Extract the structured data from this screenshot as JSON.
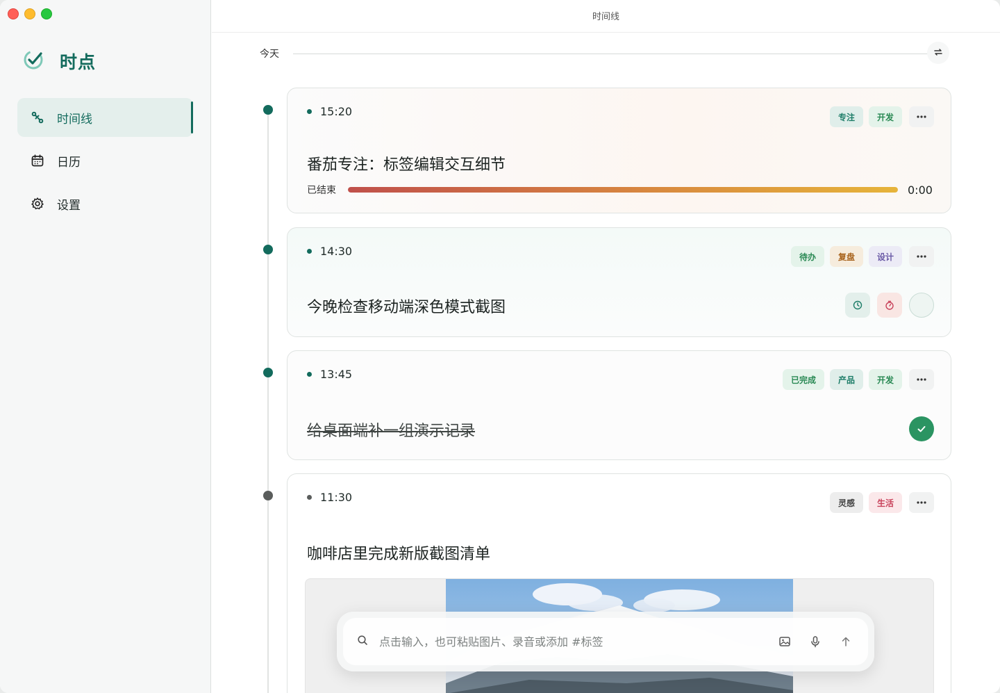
{
  "app": {
    "name": "时点",
    "window_title": "时间线"
  },
  "sidebar": {
    "items": [
      {
        "label": "时间线",
        "icon": "timeline-icon",
        "active": true
      },
      {
        "label": "日历",
        "icon": "calendar-icon",
        "active": false
      },
      {
        "label": "设置",
        "icon": "gear-icon",
        "active": false
      }
    ]
  },
  "timeline": {
    "day_label": "今天",
    "entries": [
      {
        "time": "15:20",
        "tags": [
          "专注",
          "开发"
        ],
        "title": "番茄专注：标签编辑交互细节",
        "status_label": "已结束",
        "remaining": "0:00",
        "progress": 1.0
      },
      {
        "time": "14:30",
        "tags": [
          "待办",
          "复盘",
          "设计"
        ],
        "title": "今晚检查移动端深色模式截图"
      },
      {
        "time": "13:45",
        "tags": [
          "已完成",
          "产品",
          "开发"
        ],
        "title": "给桌面端补一组演示记录"
      },
      {
        "time": "11:30",
        "tags": [
          "灵感",
          "生活"
        ],
        "title": "咖啡店里完成新版截图清单"
      }
    ]
  },
  "composer": {
    "placeholder": "点击输入，也可粘贴图片、录音或添加 #标签"
  },
  "colors": {
    "accent": "#136b5d",
    "done_green": "#2b9462"
  }
}
